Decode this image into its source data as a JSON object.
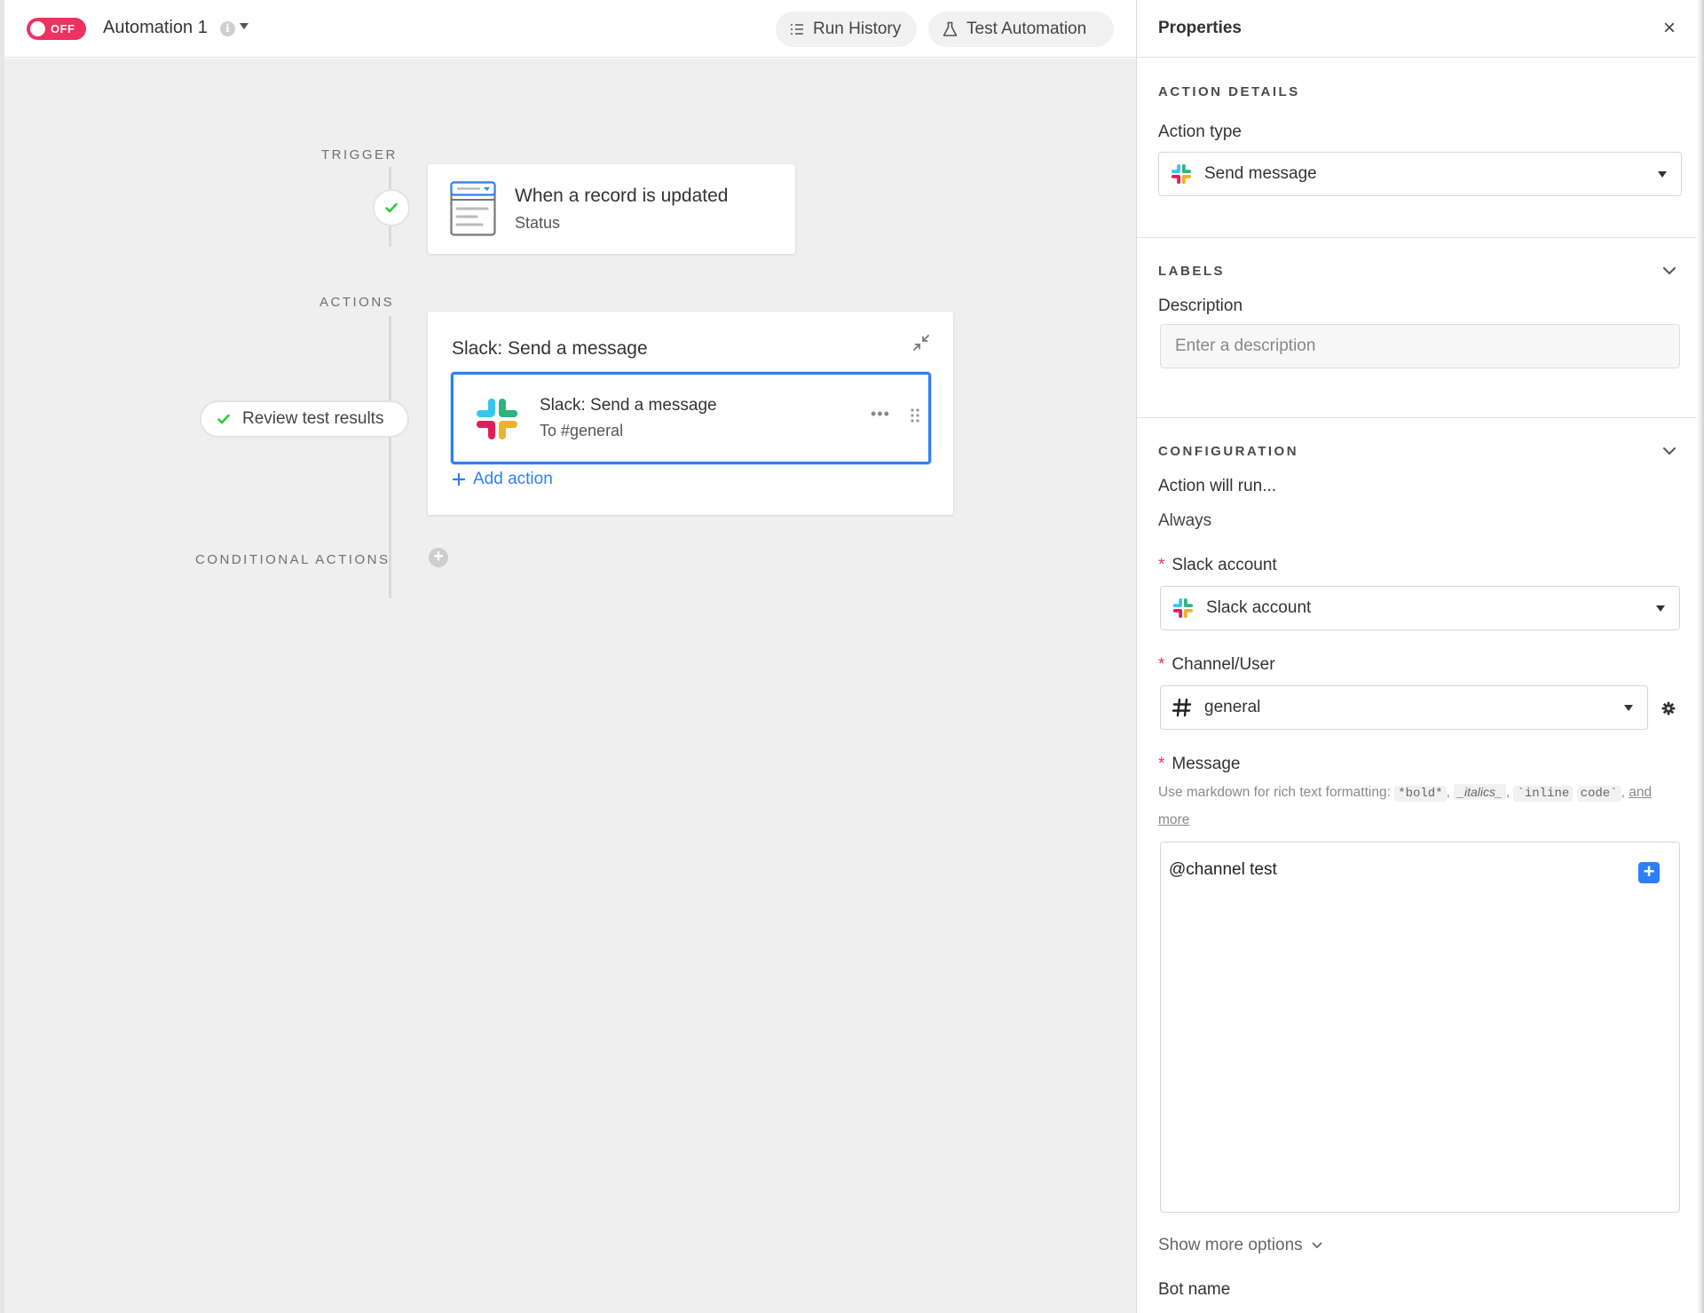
{
  "header": {
    "toggle_label": "OFF",
    "automation_name": "Automation 1",
    "info_glyph": "i",
    "run_history_label": "Run History",
    "test_automation_label": "Test Automation"
  },
  "canvas": {
    "trigger_label": "TRIGGER",
    "actions_label": "ACTIONS",
    "conditional_label": "CONDITIONAL ACTIONS",
    "trigger_card": {
      "title": "When a record is updated",
      "subtitle": "Status"
    },
    "action_group": {
      "title": "Slack: Send a message",
      "item_title": "Slack: Send a message",
      "item_subtitle": "To #general",
      "more_glyph": "•••",
      "add_action_label": "Add action"
    },
    "review_label": "Review test results",
    "add_conditional_glyph": "+"
  },
  "panel": {
    "title": "Properties",
    "close_glyph": "×",
    "action_details": {
      "section_title": "ACTION DETAILS",
      "action_type_label": "Action type",
      "action_type_value": "Send message"
    },
    "labels": {
      "section_title": "LABELS",
      "description_label": "Description",
      "description_placeholder": "Enter a description"
    },
    "configuration": {
      "section_title": "CONFIGURATION",
      "run_label": "Action will run...",
      "run_value": "Always",
      "required_mark": "*",
      "slack_account_label": "Slack account",
      "slack_account_value": "Slack account",
      "channel_label": "Channel/User",
      "channel_value": "general",
      "message_label": "Message",
      "hint_prefix": "Use markdown for rich text formatting:",
      "hint_bold": "*bold*",
      "hint_italics": "_italics_",
      "hint_code_a": "`inline",
      "hint_code_b": "code`",
      "hint_sep": ",",
      "hint_link": "and more",
      "message_value": "@channel test",
      "message_plus_glyph": "+",
      "show_more_label": "Show more options",
      "bot_name_label": "Bot name"
    }
  },
  "colors": {
    "accent": "#2d7ff9",
    "toggle_off": "#ef3061",
    "success": "#20c933",
    "required": "#e0365c",
    "slack_blue": "#36c5f0",
    "slack_green": "#2eb67d",
    "slack_red": "#e01e5a",
    "slack_yellow": "#ecb22e"
  },
  "icons": {
    "toggle": "toggle-switch-icon",
    "info": "info-icon",
    "run_history": "list-icon",
    "test": "beaker-icon",
    "trigger": "record-updated-icon",
    "check": "check-icon",
    "slack": "slack-logo-icon",
    "collapse": "collapse-arrows-icon",
    "drag": "drag-handle-icon",
    "plus": "plus-icon",
    "chevron": "chevron-down-icon",
    "hash": "hash-icon",
    "gear": "gear-icon"
  }
}
